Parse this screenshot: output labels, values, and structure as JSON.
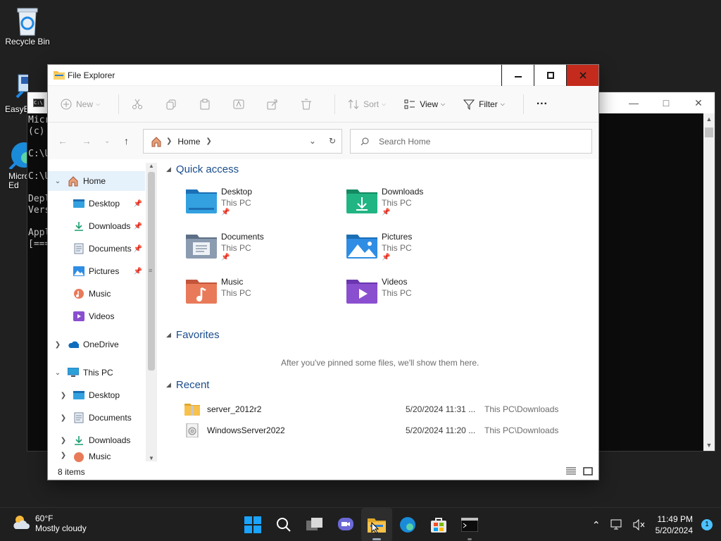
{
  "desktop": {
    "icons": [
      {
        "label": "Recycle Bin"
      },
      {
        "label": "EasyBC"
      },
      {
        "label": "Micro Ed"
      }
    ]
  },
  "console": {
    "lines": [
      "Micr",
      "(c)",
      "",
      "C:\\U",
      "",
      "C:\\U",
      "",
      "Depl",
      "Vers",
      "",
      "Appl",
      "[==="
    ]
  },
  "explorer": {
    "title": "File Explorer",
    "toolbar": {
      "new": "New",
      "sort": "Sort",
      "view": "View",
      "filter": "Filter",
      "more": "···"
    },
    "address": {
      "location": "Home"
    },
    "search": {
      "placeholder": "Search Home"
    },
    "nav": {
      "home": "Home",
      "pinned": [
        "Desktop",
        "Downloads",
        "Documents",
        "Pictures",
        "Music",
        "Videos"
      ],
      "onedrive": "OneDrive",
      "thispc": "This PC",
      "thispc_children": [
        "Desktop",
        "Documents",
        "Downloads",
        "Music"
      ]
    },
    "quick_access": {
      "title": "Quick access",
      "items": [
        {
          "name": "Desktop",
          "sub": "This PC"
        },
        {
          "name": "Downloads",
          "sub": "This PC"
        },
        {
          "name": "Documents",
          "sub": "This PC"
        },
        {
          "name": "Pictures",
          "sub": "This PC"
        },
        {
          "name": "Music",
          "sub": "This PC"
        },
        {
          "name": "Videos",
          "sub": "This PC"
        }
      ]
    },
    "favorites": {
      "title": "Favorites",
      "empty": "After you've pinned some files, we'll show them here."
    },
    "recent": {
      "title": "Recent",
      "rows": [
        {
          "name": "server_2012r2",
          "date": "5/20/2024 11:31 ...",
          "location": "This PC\\Downloads"
        },
        {
          "name": "WindowsServer2022",
          "date": "5/20/2024 11:20 ...",
          "location": "This PC\\Downloads"
        }
      ]
    },
    "status": "8 items"
  },
  "taskbar": {
    "weather_temp": "60°F",
    "weather_desc": "Mostly cloudy",
    "time": "11:49 PM",
    "date": "5/20/2024",
    "notifications": "1"
  },
  "colors": {
    "accent": "#0067c0",
    "close": "#c42b1c",
    "folder": "#f8c14b"
  }
}
